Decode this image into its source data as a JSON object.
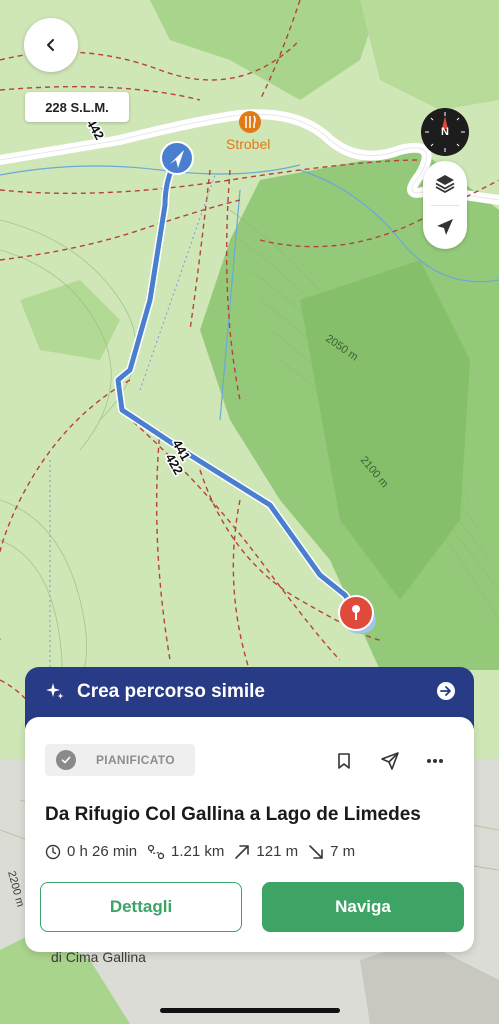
{
  "map": {
    "elevation_badge": "228 S.L.M.",
    "poi_name": "Strobel",
    "contour_labels": [
      "2050 m",
      "2100 m"
    ],
    "trail_labels": [
      "441",
      "422",
      "442"
    ],
    "bottom_label": "di Cima Gallina",
    "side_label": "2200 m"
  },
  "controls": {
    "back_icon": "chevron-left-icon",
    "compass_label": "N",
    "layers_icon": "layers-icon",
    "locate_icon": "location-arrow-icon"
  },
  "similar_route": {
    "label": "Crea percorso simile",
    "icon": "sparkles-icon",
    "arrow_icon": "arrow-right-circle-icon"
  },
  "route_card": {
    "status": "PIANIFICATO",
    "title": "Da Rifugio Col Gallina a Lago de Limedes",
    "stats": {
      "duration": "0 h 26 min",
      "distance": "1.21 km",
      "ascent": "121 m",
      "descent": "7 m"
    },
    "details_label": "Dettagli",
    "navigate_label": "Naviga"
  },
  "colors": {
    "route": "#4a7fd0",
    "panel_header": "#283b86",
    "accent_green": "#3ea466",
    "destination_pin": "#e04a3a",
    "poi": "#e07a17"
  }
}
